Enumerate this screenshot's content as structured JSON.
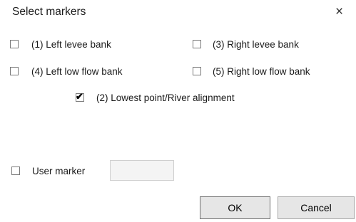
{
  "dialog": {
    "title": "Select markers",
    "close_glyph": "×"
  },
  "markers": [
    {
      "label": "(1) Left levee bank",
      "checked": false
    },
    {
      "label": "(3) Right levee bank",
      "checked": false
    },
    {
      "label": "(4) Left low flow bank",
      "checked": false
    },
    {
      "label": "(5) Right low flow bank",
      "checked": false
    },
    {
      "label": "(2) Lowest point/River alignment",
      "checked": true
    }
  ],
  "user_marker": {
    "label": "User marker",
    "checked": false,
    "value": ""
  },
  "buttons": {
    "ok_label": "OK",
    "cancel_label": "Cancel"
  },
  "icons": {
    "close": "close-icon",
    "check": "checkmark-icon"
  }
}
